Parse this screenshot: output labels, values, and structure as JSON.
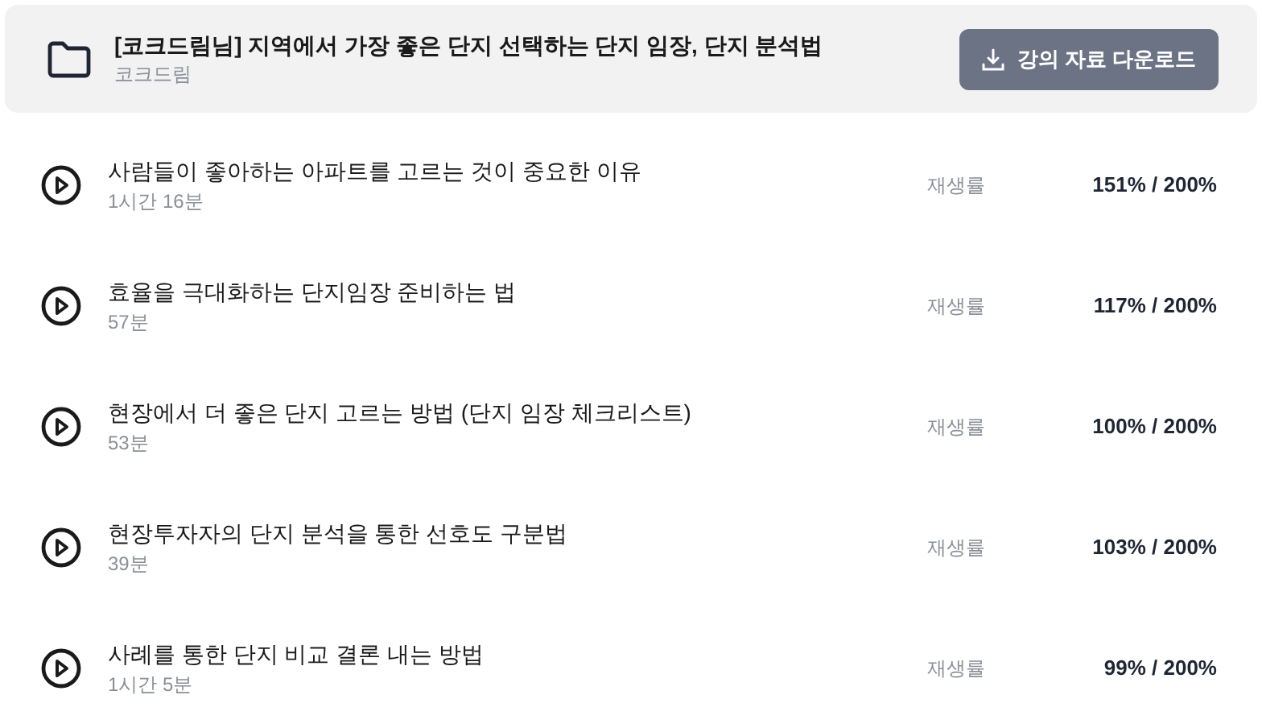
{
  "course": {
    "title": "[코크드림님] 지역에서 가장 좋은 단지 선택하는 단지 임장, 단지 분석법",
    "author": "코크드림",
    "download_button": "강의 자료 다운로드"
  },
  "lessons": [
    {
      "title": "사람들이 좋아하는 아파트를 고르는 것이 중요한 이유",
      "duration": "1시간 16분",
      "rate_label": "재생률",
      "rate": "151% / 200%"
    },
    {
      "title": "효율을 극대화하는 단지임장 준비하는 법",
      "duration": "57분",
      "rate_label": "재생률",
      "rate": "117% / 200%"
    },
    {
      "title": "현장에서 더 좋은 단지 고르는 방법 (단지 임장 체크리스트)",
      "duration": "53분",
      "rate_label": "재생률",
      "rate": "100% / 200%"
    },
    {
      "title": "현장투자자의 단지 분석을 통한 선호도 구분법",
      "duration": "39분",
      "rate_label": "재생률",
      "rate": "103% / 200%"
    },
    {
      "title": "사례를 통한 단지 비교 결론 내는 방법",
      "duration": "1시간 5분",
      "rate_label": "재생률",
      "rate": "99% / 200%"
    }
  ]
}
